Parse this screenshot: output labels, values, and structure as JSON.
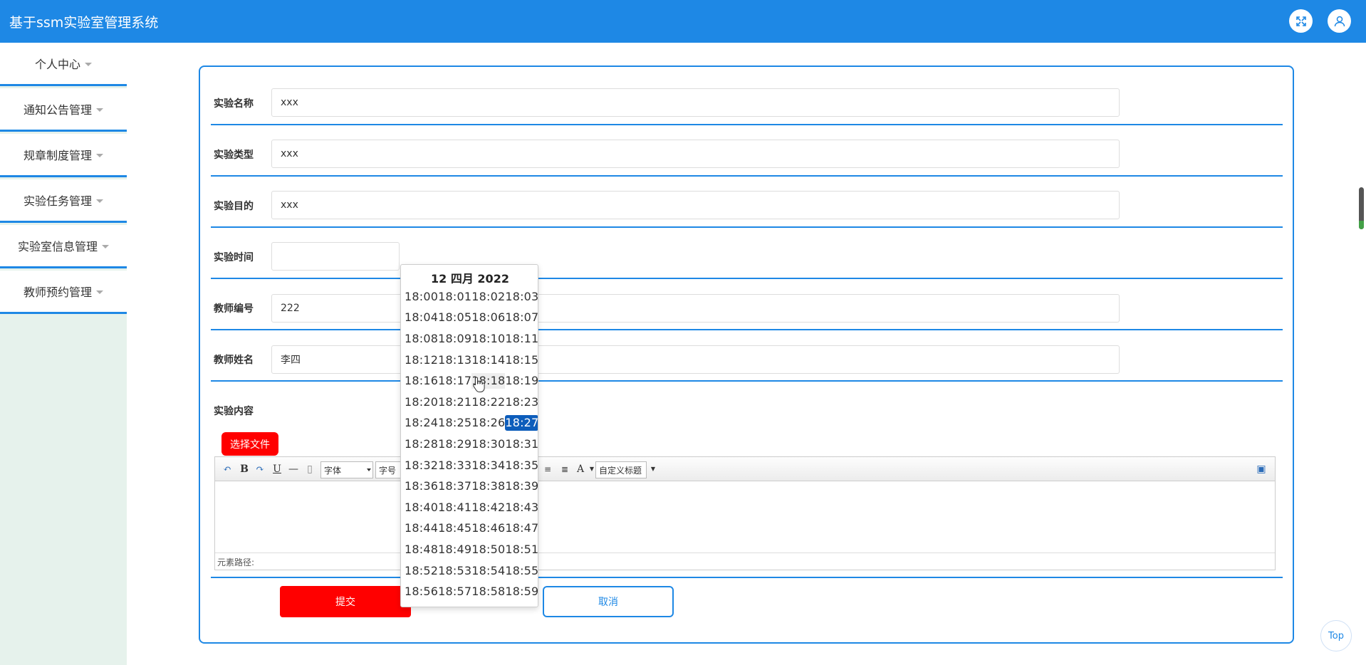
{
  "header": {
    "title": "基于ssm实验室管理系统",
    "icons": [
      "fullscreen-icon",
      "user-icon"
    ]
  },
  "sidebar": {
    "items": [
      {
        "label": "个人中心"
      },
      {
        "label": "通知公告管理"
      },
      {
        "label": "规章制度管理"
      },
      {
        "label": "实验任务管理"
      },
      {
        "label": "实验室信息管理"
      },
      {
        "label": "教师预约管理"
      }
    ]
  },
  "form": {
    "fields": [
      {
        "label": "实验名称",
        "value": "xxx"
      },
      {
        "label": "实验类型",
        "value": "xxx"
      },
      {
        "label": "实验目的",
        "value": "xxx"
      },
      {
        "label": "实验时间",
        "value": ""
      },
      {
        "label": "教师编号",
        "value": "222"
      },
      {
        "label": "教师姓名",
        "value": "李四"
      }
    ],
    "content_label": "实验内容",
    "upload_label": "选择文件",
    "submit_label": "提交",
    "cancel_label": "取消"
  },
  "editor": {
    "font_family": "字体",
    "font_size": "字号",
    "custom_title": "自定义标题",
    "status": "元素路径:"
  },
  "datepicker": {
    "header": "12 四月 2022",
    "rows": [
      [
        "18:00",
        "18:01",
        "18:02",
        "18:03"
      ],
      [
        "18:04",
        "18:05",
        "18:06",
        "18:07"
      ],
      [
        "18:08",
        "18:09",
        "18:10",
        "18:11"
      ],
      [
        "18:12",
        "18:13",
        "18:14",
        "18:15"
      ],
      [
        "18:16",
        "18:17",
        "18:18",
        "18:19"
      ],
      [
        "18:20",
        "18:21",
        "18:22",
        "18:23"
      ],
      [
        "18:24",
        "18:25",
        "18:26",
        "18:27"
      ],
      [
        "18:28",
        "18:29",
        "18:30",
        "18:31"
      ],
      [
        "18:32",
        "18:33",
        "18:34",
        "18:35"
      ],
      [
        "18:36",
        "18:37",
        "18:38",
        "18:39"
      ],
      [
        "18:40",
        "18:41",
        "18:42",
        "18:43"
      ],
      [
        "18:44",
        "18:45",
        "18:46",
        "18:47"
      ],
      [
        "18:48",
        "18:49",
        "18:50",
        "18:51"
      ],
      [
        "18:52",
        "18:53",
        "18:54",
        "18:55"
      ],
      [
        "18:56",
        "18:57",
        "18:58",
        "18:59"
      ]
    ],
    "selected": "18:27",
    "hovered": "18:18"
  },
  "back_to_top": "Top",
  "colors": {
    "primary": "#1e88e5",
    "danger": "#ff0000",
    "sidebar_bg": "#e6f2ec",
    "selected": "#0d5dbb"
  }
}
